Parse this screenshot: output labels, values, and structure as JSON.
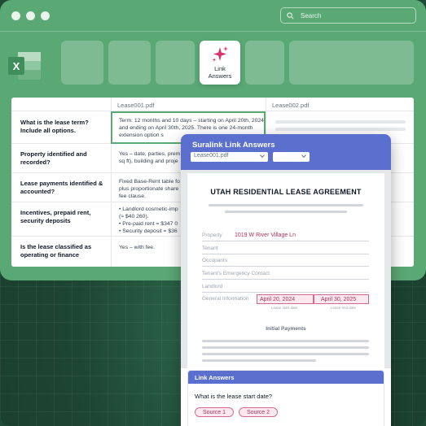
{
  "search": {
    "placeholder": "Search"
  },
  "ribbon": {
    "active_tile_label": "Link\nAnswers"
  },
  "sheet": {
    "columns": [
      "Lease001.pdf",
      "Lease002.pdf"
    ],
    "rows": [
      {
        "question": "What is the lease term? Include all options.",
        "answer": "Term: 12 months and 10 days – starting on April 20th, 2024 and ending on April 30th, 2025. There is one 24-month extension option s"
      },
      {
        "question": "Property identified and recorded?",
        "answer": "Yes – date, parties, prem\nsq ft), building and proje"
      },
      {
        "question": "Lease payments identified & accounted?",
        "answer": "Fixed Base-Rent table fo\nplus proportionate share\nfee clause."
      },
      {
        "question": "Incentives, prepaid rent, security deposits",
        "answer": "• Landlord cosmetic-imp\n(≈ $40 260).\n• Pre-paid rent = $347 0\n• Security deposit = $36"
      },
      {
        "question": "Is the lease classified as operating or finance",
        "answer": "Yes – with fee."
      }
    ]
  },
  "panel": {
    "title": "Suralink Link Answers",
    "file_select": "Lease001.pdf",
    "second_select": "",
    "document": {
      "title": "UTAH RESIDENTIAL LEASE AGREEMENT",
      "fields": [
        {
          "label": "Property",
          "value": "1019 W River Village Ln"
        },
        {
          "label": "Tenant"
        },
        {
          "label": "Occupants"
        },
        {
          "label": "Tenant's Emergency Contact"
        },
        {
          "label": "Landlord"
        },
        {
          "label": "General Information"
        }
      ],
      "lease_start": "April 20, 2024",
      "lease_end": "April 30, 2025",
      "lease_start_caption": "Lease start date",
      "lease_end_caption": "Lease end date",
      "section": "Initial Payments"
    },
    "answers": {
      "header": "Link Answers",
      "question": "What is the lease start date?",
      "sources": [
        "Source 1",
        "Source 2"
      ]
    }
  }
}
